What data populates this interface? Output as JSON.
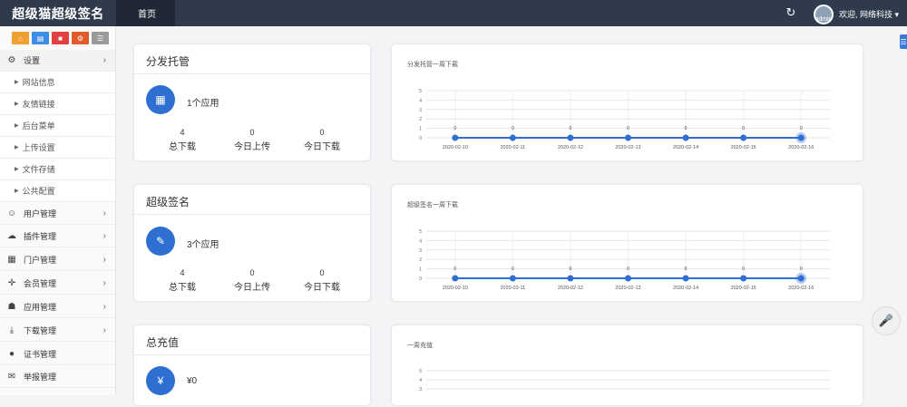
{
  "header": {
    "brand": "超级猫超级签名",
    "tab": "首页",
    "avatar_text": "admin",
    "welcome": "欢迎, 网络科技 ▾"
  },
  "sidebar": {
    "shortcut_colors": [
      "#f0a030",
      "#3a8ee6",
      "#e04040",
      "#e05a2a",
      "#9a9a9a"
    ],
    "items": [
      {
        "label": "设置",
        "icon": "gears-icon"
      },
      {
        "label": "用户管理",
        "icon": "users-icon"
      },
      {
        "label": "插件管理",
        "icon": "cloud-icon"
      },
      {
        "label": "门户管理",
        "icon": "grid-icon"
      },
      {
        "label": "会员管理",
        "icon": "move-icon"
      },
      {
        "label": "应用管理",
        "icon": "android-icon"
      },
      {
        "label": "下载管理",
        "icon": "download-icon"
      },
      {
        "label": "证书管理",
        "icon": "circle-icon"
      },
      {
        "label": "举报管理",
        "icon": "envelope-icon"
      }
    ],
    "sub_items": [
      "网站信息",
      "友情链接",
      "后台菜单",
      "上传设置",
      "文件存储",
      "公共配置"
    ]
  },
  "cards": [
    {
      "title": "分发托管",
      "apps": "1个应用",
      "stats": [
        {
          "value": "4",
          "label": "总下载"
        },
        {
          "value": "0",
          "label": "今日上传"
        },
        {
          "value": "0",
          "label": "今日下载"
        }
      ]
    },
    {
      "title": "超级签名",
      "apps": "3个应用",
      "stats": [
        {
          "value": "4",
          "label": "总下载"
        },
        {
          "value": "0",
          "label": "今日上传"
        },
        {
          "value": "0",
          "label": "今日下载"
        }
      ]
    },
    {
      "title": "总充值",
      "apps": "¥0",
      "stats": []
    }
  ],
  "chart_data": [
    {
      "type": "line",
      "title": "分发托管一周下载",
      "categories": [
        "2020-02-10",
        "2020-02-11",
        "2020-02-12",
        "2020-02-13",
        "2020-02-14",
        "2020-02-15",
        "2020-02-16"
      ],
      "values": [
        0,
        0,
        0,
        0,
        0,
        0,
        0
      ],
      "yticks": [
        0,
        1,
        2,
        3,
        4,
        5
      ],
      "ylim": [
        0,
        5
      ],
      "grid": true,
      "color": "#2f6fd2"
    },
    {
      "type": "line",
      "title": "超级签名一周下载",
      "categories": [
        "2020-02-10",
        "2020-02-11",
        "2020-02-12",
        "2020-02-13",
        "2020-02-14",
        "2020-02-15",
        "2020-02-16"
      ],
      "values": [
        0,
        0,
        0,
        0,
        0,
        0,
        0
      ],
      "yticks": [
        0,
        1,
        2,
        3,
        4,
        5
      ],
      "ylim": [
        0,
        5
      ],
      "grid": true,
      "color": "#2f6fd2"
    },
    {
      "type": "line",
      "title": "一周充值",
      "categories": [],
      "values": [],
      "yticks": [
        3,
        4,
        5
      ],
      "ylim": [
        0,
        5
      ],
      "grid": true,
      "color": "#2f6fd2"
    }
  ]
}
